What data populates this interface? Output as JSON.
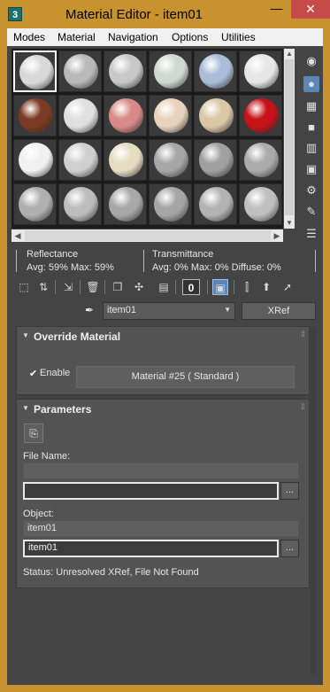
{
  "window": {
    "title": "Material Editor - item01",
    "app_icon": "3",
    "minimize_glyph": "—",
    "close_glyph": "✕"
  },
  "menu": [
    "Modes",
    "Material",
    "Navigation",
    "Options",
    "Utilities"
  ],
  "slots": {
    "spheres": [
      "#d9d9d9",
      "#b9b9b9",
      "#c8c8c8",
      "#cfd9d3",
      "#a9bcd8",
      "#e6e6e6",
      "#7a3b22",
      "#e0e0e0",
      "#d98a88",
      "#e8d2bd",
      "#dbc6a6",
      "#c7121a",
      "#f0f0f0",
      "#cfcfcf",
      "#e6dcc2",
      "#a7a7a7",
      "#a0a0a0",
      "#ababab",
      "#b0b0b0",
      "#bdbdbd",
      "#a8a8a8",
      "#a6a6a6",
      "#b3b3b3",
      "#c0c0c0"
    ],
    "selected_index": 0
  },
  "side_tools": [
    "sphere-type-icon",
    "backlight-icon",
    "background-icon",
    "sample-uv-tiling-icon",
    "video-color-check-icon",
    "make-preview-icon",
    "options-icon",
    "select-by-material-icon",
    "material-map-navigator-icon"
  ],
  "reflectance": {
    "heading": "Reflectance",
    "values": "Avg:  59% Max:  59%"
  },
  "transmittance": {
    "heading": "Transmittance",
    "values": "Avg:    0% Max:    0%  Diffuse:   0%"
  },
  "toolbar_zero": "0",
  "name_row": {
    "material_name": "item01",
    "type_button": "XRef"
  },
  "override": {
    "title": "Override Material",
    "enable_label": "Enable",
    "enable_checked": "✔",
    "material_button": "Material #25  ( Standard )"
  },
  "parameters": {
    "title": "Parameters",
    "file_name_label": "File Name:",
    "file_name_value": "",
    "file_browse": "...",
    "object_label": "Object:",
    "object_display": "item01",
    "object_value": "item01",
    "object_browse": "...",
    "status": "Status: Unresolved XRef, File Not Found"
  }
}
